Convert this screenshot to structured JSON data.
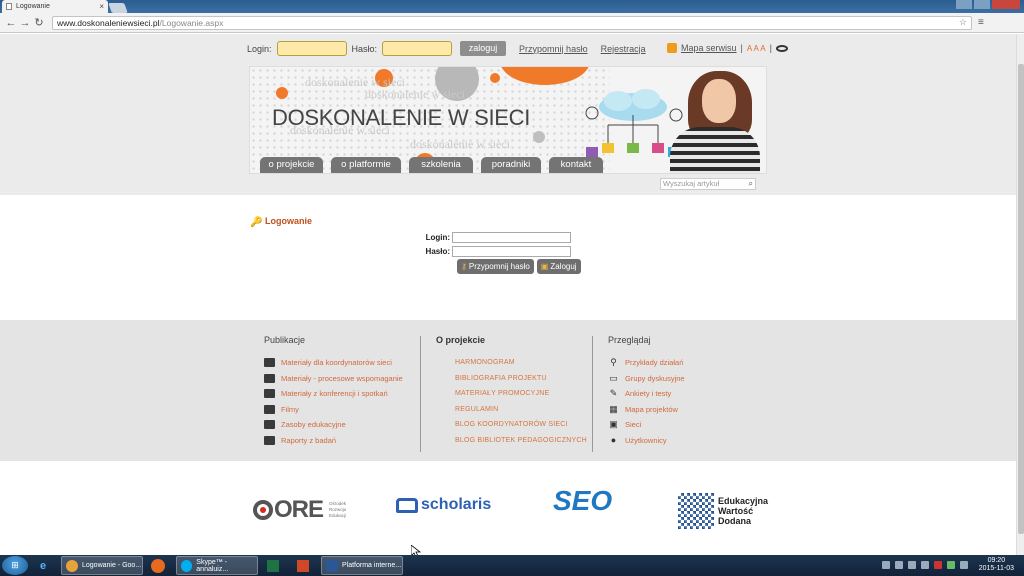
{
  "browser": {
    "tab_title": "Logowanie",
    "tab_close": "×",
    "url_host": "www.doskonaleniewsieci.pl",
    "url_path": "/Logowanie.aspx",
    "nav_back": "←",
    "nav_forward": "→",
    "nav_reload": "↻",
    "star": "☆",
    "menu": "≡"
  },
  "loginbar": {
    "login_label": "Login:",
    "password_label": "Hasło:",
    "submit_label": "zaloguj",
    "remind_link": "Przypomnij hasło",
    "register_link": "Rejestracja"
  },
  "service": {
    "rss": "RSS",
    "sitemap_link": "Mapa serwisu",
    "font_sizes": "A A A"
  },
  "banner": {
    "title": "DOSKONALENIE W SIECI",
    "ghost_text": "doskonalenie w sieci"
  },
  "nav": {
    "items": [
      "o projekcie",
      "o platformie",
      "szkolenia",
      "poradniki",
      "kontakt"
    ]
  },
  "search": {
    "placeholder": "Wyszukaj artykuł"
  },
  "login": {
    "heading": "Logowanie",
    "login_label": "Login:",
    "password_label": "Hasło:",
    "remind_button": "Przypomnij hasło",
    "submit_button": "Zaloguj"
  },
  "footer": {
    "publications": {
      "title": "Publikacje",
      "items": [
        "Materiały dla koordynatorów sieci",
        "Materiały - procesowe wspomaganie",
        "Materiały z konferencji i spotkań",
        "Filmy",
        "Zasoby edukacyjne",
        "Raporty z badań"
      ]
    },
    "project": {
      "title": "O projekcie",
      "items": [
        "HARMONOGRAM",
        "BIBLIOGRAFIA PROJEKTU",
        "MATERIAŁY PROMOCYJNE",
        "REGULAMIN",
        "BLOG KOORDYNATORÓW SIECI",
        "BLOG BIBLIOTEK PEDAGOGICZNYCH"
      ]
    },
    "browse": {
      "title": "Przeglądaj",
      "items": [
        "Przykłady działań",
        "Grupy dyskusyjne",
        "Ankiety i testy",
        "Mapa projektów",
        "Sieci",
        "Użytkownicy"
      ]
    }
  },
  "logos": {
    "ore": "ORE",
    "ore_sub": "Ośrodek Rozwoju Edukacji",
    "scholaris": "scholaris",
    "seo": "SEO",
    "ewd": "Edukacyjna Wartość Dodana"
  },
  "taskbar": {
    "start": "⊞",
    "ie": "e",
    "tasks": [
      {
        "label": "Logowanie - Goo...",
        "color": "#e8a23a"
      },
      {
        "label": "Skype™ - annaluiz...",
        "color": "#00aff0"
      },
      {
        "label": "Platforma interne...",
        "color": "#2b5797"
      }
    ],
    "time": "09:20",
    "date": "2015-11-03"
  }
}
